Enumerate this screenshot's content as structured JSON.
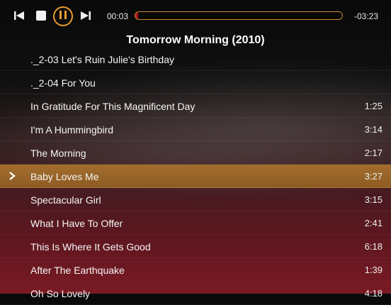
{
  "transport": {
    "elapsed": "00:03",
    "remaining": "-03:23",
    "progress": 0.015
  },
  "album": {
    "title": "Tomorrow Morning (2010)"
  },
  "tracks": [
    {
      "name": "._2-03 Let's Ruin Julie's Birthday",
      "duration": ""
    },
    {
      "name": "._2-04 For You",
      "duration": ""
    },
    {
      "name": "In Gratitude For This Magnificent Day",
      "duration": "1:25"
    },
    {
      "name": "I'm A Hummingbird",
      "duration": "3:14"
    },
    {
      "name": "The Morning",
      "duration": "2:17"
    },
    {
      "name": "Baby Loves Me",
      "duration": "3:27",
      "playing": true
    },
    {
      "name": "Spectacular Girl",
      "duration": "3:15"
    },
    {
      "name": "What I Have To Offer",
      "duration": "2:41"
    },
    {
      "name": "This Is Where It Gets Good",
      "duration": "6:18"
    },
    {
      "name": "After The Earthquake",
      "duration": "1:39"
    },
    {
      "name": "Oh So Lovely",
      "duration": "4:18"
    }
  ],
  "colors": {
    "accent": "#e89b2e",
    "progress_fill": "#b0141e",
    "playing_row": "#a36e2e"
  },
  "icons": {
    "previous": "skip-back-icon",
    "stop": "stop-icon",
    "pause": "pause-icon",
    "next": "skip-forward-icon",
    "now_playing": "chevron-right-icon"
  }
}
